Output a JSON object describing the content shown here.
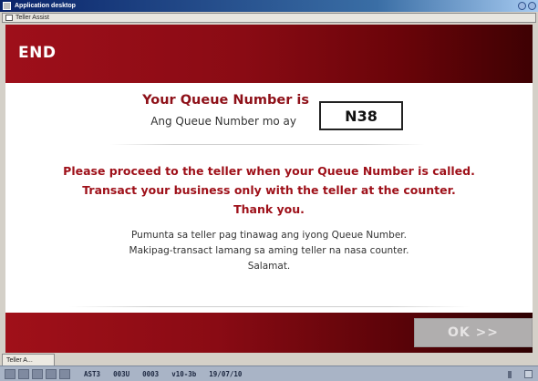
{
  "window": {
    "title": "Application desktop",
    "app_title": "Teller Assist"
  },
  "header": {
    "title": "END"
  },
  "queue": {
    "label_en": "Your Queue Number is",
    "label_tl": "Ang Queue Number mo ay",
    "number": "N38"
  },
  "message_en": {
    "line1": "Please proceed to the teller when your Queue Number is called.",
    "line2": "Transact your business only with the teller at the counter.",
    "line3": "Thank you."
  },
  "message_tl": {
    "line1": "Pumunta sa teller pag tinawag ang iyong Queue Number.",
    "line2": "Makipag-transact lamang sa aming teller na nasa counter.",
    "line3": "Salamat."
  },
  "footer": {
    "ok_label": "OK  >>"
  },
  "taskbar": {
    "tab_label": "Teller A..."
  },
  "status_bar": {
    "fields": [
      "AST3",
      "003U",
      "0003",
      "v10-3b",
      "19/07/10"
    ]
  },
  "colors": {
    "brand_red": "#9e1019",
    "header_gradient_start": "#9e0f1a",
    "header_gradient_end": "#3e0103",
    "ok_disabled": "#b0aeae"
  }
}
